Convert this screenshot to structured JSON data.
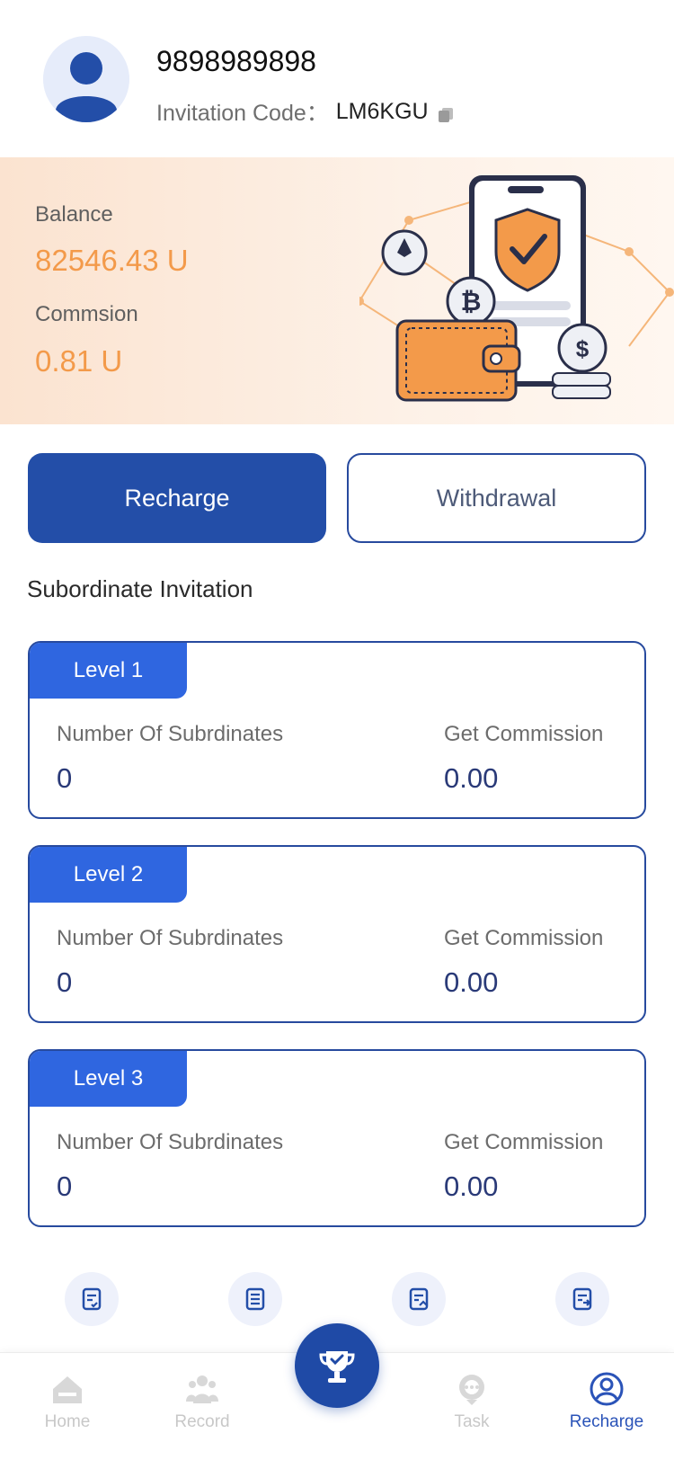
{
  "profile": {
    "phone": "9898989898",
    "invitation_label": "Invitation Code：",
    "invitation_code": "LM6KGU"
  },
  "wallet": {
    "balance_label": "Balance",
    "balance_value": "82546.43 U",
    "commission_label": "Commsion",
    "commission_value": "0.81 U"
  },
  "actions": {
    "recharge_label": "Recharge",
    "withdrawal_label": "Withdrawal"
  },
  "subordinate": {
    "title": "Subordinate Invitation",
    "levels": [
      {
        "tag": "Level 1",
        "subordinates_label": "Number Of Subrdinates",
        "subordinates_value": "0",
        "commission_label": "Get Commission",
        "commission_value": "0.00"
      },
      {
        "tag": "Level 2",
        "subordinates_label": "Number Of Subrdinates",
        "subordinates_value": "0",
        "commission_label": "Get Commission",
        "commission_value": "0.00"
      },
      {
        "tag": "Level 3",
        "subordinates_label": "Number Of Subrdinates",
        "subordinates_value": "0",
        "commission_label": "Get Commission",
        "commission_value": "0.00"
      }
    ]
  },
  "quick_links": [
    {
      "icon": "task-list-icon"
    },
    {
      "icon": "balance-record-icon"
    },
    {
      "icon": "recharge-record-icon"
    },
    {
      "icon": "withdrawal-record-icon"
    }
  ],
  "tabbar": {
    "items": [
      {
        "label": "Home",
        "icon": "home-icon",
        "active": false
      },
      {
        "label": "Record",
        "icon": "record-icon",
        "active": false
      },
      {
        "label": "Task",
        "icon": "task-icon",
        "active": false
      },
      {
        "label": "Recharge",
        "icon": "profile-icon",
        "active": true
      }
    ],
    "center_icon": "trophy-icon"
  },
  "colors": {
    "primary": "#234ea8",
    "accent_orange": "#f39a4a",
    "level_tag": "#2f66e0",
    "panel_bg": "#fbe3d0"
  }
}
